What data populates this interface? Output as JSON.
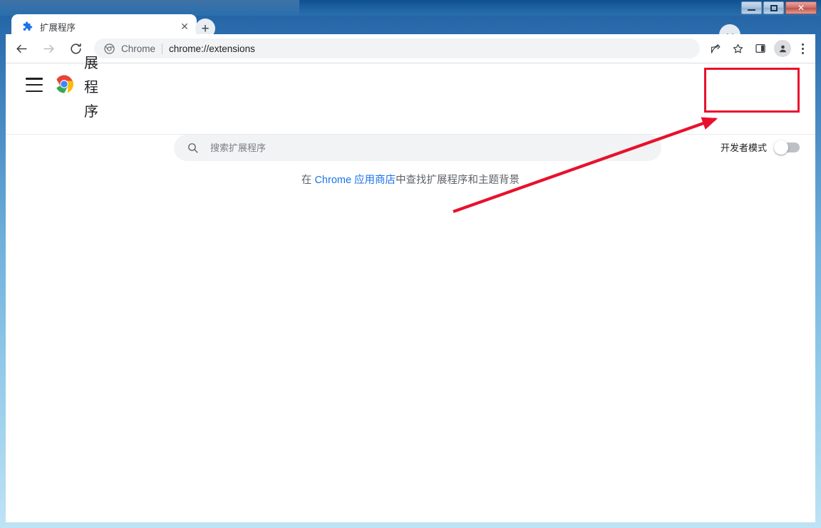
{
  "window": {
    "controls": {
      "minimize_label": "Minimize",
      "maximize_label": "Maximize",
      "close_label": "✕"
    }
  },
  "tabstrip": {
    "tabs": [
      {
        "title": "扩展程序",
        "favicon": "puzzle-piece-icon",
        "close_label": "✕",
        "active": true
      }
    ],
    "new_tab_label": "+",
    "tab_search_label": "⌄"
  },
  "toolbar": {
    "back_label": "←",
    "forward_label": "→",
    "reload_label": "⟳",
    "omnibox": {
      "scheme_chip": "Chrome",
      "url": "chrome://extensions",
      "icons": [
        "chrome-icon"
      ]
    },
    "right_icons": [
      {
        "name": "share-icon",
        "label": ""
      },
      {
        "name": "bookmark-star-icon",
        "label": ""
      },
      {
        "name": "side-panel-icon",
        "label": ""
      },
      {
        "name": "profile-avatar",
        "label": ""
      },
      {
        "name": "more-menu-icon",
        "label": ""
      }
    ]
  },
  "extensions_page": {
    "menu_label": "",
    "title": "展程序",
    "search": {
      "placeholder": "搜索扩展程序",
      "value": ""
    },
    "developer_mode": {
      "label": "开发者模式",
      "enabled": false
    },
    "empty_state": {
      "prefix": "在 ",
      "link_text": "Chrome 应用商店",
      "suffix": "中查找扩展程序和主题背景"
    }
  },
  "annotation": {
    "highlight_color": "#e8112d",
    "box_target": "开发者模式",
    "arrow_label": "points-to-developer-mode-toggle"
  },
  "colors": {
    "accent_blue": "#1a73e8",
    "frame_blue": "#2b6cad",
    "annotation_red": "#e8112d",
    "toolbar_bg": "#ffffff",
    "field_bg": "#f1f3f4"
  }
}
